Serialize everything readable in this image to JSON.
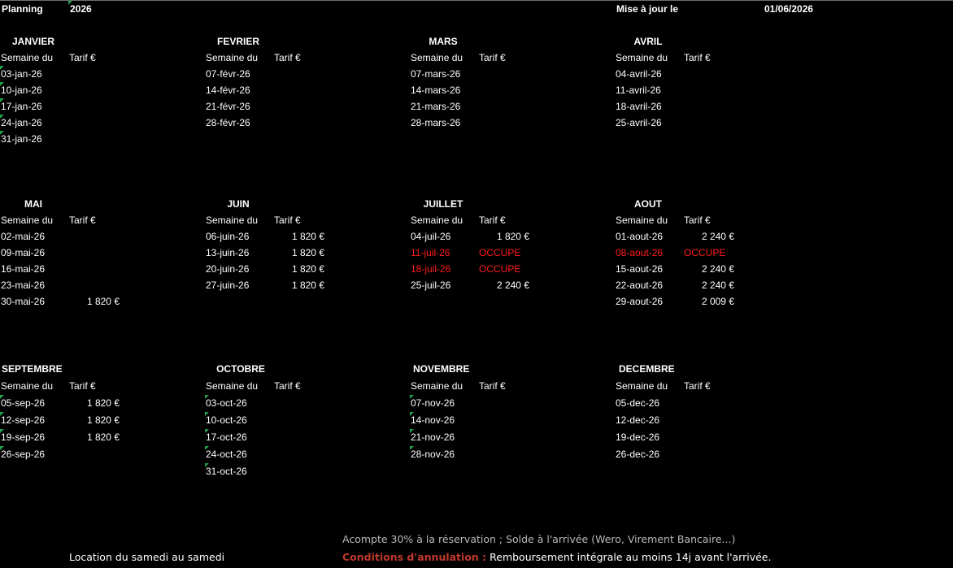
{
  "header": {
    "label": "Planning",
    "year": "2026",
    "update_label": "Mise à jour le",
    "update_date": "01/06/2026"
  },
  "col_headers": {
    "week": "Semaine du",
    "price": "Tarif €"
  },
  "months": [
    {
      "name": "JANVIER",
      "rows": [
        {
          "week": "03-jan-26",
          "price": ""
        },
        {
          "week": "10-jan-26",
          "price": ""
        },
        {
          "week": "17-jan-26",
          "price": ""
        },
        {
          "week": "24-jan-26",
          "price": ""
        },
        {
          "week": "31-jan-26",
          "price": ""
        }
      ]
    },
    {
      "name": "FEVRIER",
      "rows": [
        {
          "week": "07-févr-26",
          "price": ""
        },
        {
          "week": "14-févr-26",
          "price": ""
        },
        {
          "week": "21-févr-26",
          "price": ""
        },
        {
          "week": "28-févr-26",
          "price": ""
        }
      ]
    },
    {
      "name": "MARS",
      "rows": [
        {
          "week": "07-mars-26",
          "price": ""
        },
        {
          "week": "14-mars-26",
          "price": ""
        },
        {
          "week": "21-mars-26",
          "price": ""
        },
        {
          "week": "28-mars-26",
          "price": ""
        }
      ]
    },
    {
      "name": "AVRIL",
      "rows": [
        {
          "week": "04-avril-26",
          "price": ""
        },
        {
          "week": "11-avril-26",
          "price": ""
        },
        {
          "week": "18-avril-26",
          "price": ""
        },
        {
          "week": "25-avril-26",
          "price": ""
        }
      ]
    },
    {
      "name": "MAI",
      "rows": [
        {
          "week": "02-mai-26",
          "price": ""
        },
        {
          "week": "09-mai-26",
          "price": ""
        },
        {
          "week": "16-mai-26",
          "price": ""
        },
        {
          "week": "23-mai-26",
          "price": ""
        },
        {
          "week": "30-mai-26",
          "price": "1 820 €"
        }
      ]
    },
    {
      "name": "JUIN",
      "rows": [
        {
          "week": "06-juin-26",
          "price": "1 820 €"
        },
        {
          "week": "13-juin-26",
          "price": "1 820 €"
        },
        {
          "week": "20-juin-26",
          "price": "1 820 €"
        },
        {
          "week": "27-juin-26",
          "price": "1 820 €"
        }
      ]
    },
    {
      "name": "JUILLET",
      "rows": [
        {
          "week": "04-juil-26",
          "price": "1 820 €"
        },
        {
          "week": "11-juil-26",
          "status": "OCCUPE"
        },
        {
          "week": "18-juil-26",
          "status": "OCCUPE"
        },
        {
          "week": "25-juil-26",
          "price": "2 240 €"
        }
      ]
    },
    {
      "name": "AOUT",
      "rows": [
        {
          "week": "01-aout-26",
          "price": "2 240 €"
        },
        {
          "week": "08-aout-26",
          "status": "OCCUPE"
        },
        {
          "week": "15-aout-26",
          "price": "2 240 €"
        },
        {
          "week": "22-aout-26",
          "price": "2 240 €"
        },
        {
          "week": "29-aout-26",
          "price": "2 009 €"
        }
      ]
    },
    {
      "name": "SEPTEMBRE",
      "rows": [
        {
          "week": "05-sep-26",
          "price": "1 820 €"
        },
        {
          "week": "12-sep-26",
          "price": "1 820 €"
        },
        {
          "week": "19-sep-26",
          "price": "1 820 €"
        },
        {
          "week": "26-sep-26",
          "price": ""
        }
      ]
    },
    {
      "name": "OCTOBRE",
      "rows": [
        {
          "week": "03-oct-26",
          "price": ""
        },
        {
          "week": "10-oct-26",
          "price": ""
        },
        {
          "week": "17-oct-26",
          "price": ""
        },
        {
          "week": "24-oct-26",
          "price": ""
        },
        {
          "week": "31-oct-26",
          "price": ""
        }
      ]
    },
    {
      "name": "NOVEMBRE",
      "rows": [
        {
          "week": "07-nov-26",
          "price": ""
        },
        {
          "week": "14-nov-26",
          "price": ""
        },
        {
          "week": "21-nov-26",
          "price": ""
        },
        {
          "week": "28-nov-26",
          "price": ""
        }
      ]
    },
    {
      "name": "DECEMBRE",
      "rows": [
        {
          "week": "05-dec-26",
          "price": ""
        },
        {
          "week": "12-dec-26",
          "price": ""
        },
        {
          "week": "19-dec-26",
          "price": ""
        },
        {
          "week": "26-dec-26",
          "price": ""
        }
      ]
    }
  ],
  "footer": {
    "rental_note": "Location du samedi au samedi",
    "payment_note": "Acompte 30% à la réservation ; Solde à l'arrivée (Wero, Virement Bancaire...)",
    "cancel_label": "Conditions d'annulation :",
    "cancel_text": " Remboursement intégrale au moins 14j avant l'arrivée."
  },
  "colors": {
    "background": "#000000",
    "text": "#ffffff",
    "occupied": "#ff1a1a",
    "comment_marker": "#1fa14a"
  }
}
